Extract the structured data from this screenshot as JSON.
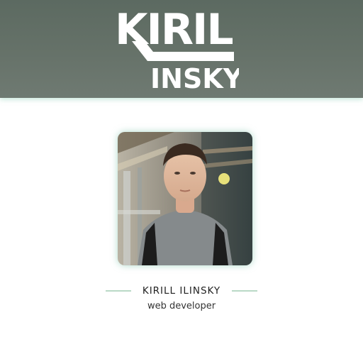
{
  "header": {
    "logo": {
      "line1": "KIRIL",
      "line2": "INSKY"
    }
  },
  "profile": {
    "photo_alt": "portrait photo",
    "name": "KIRILL ILINSKY",
    "role": "web developer"
  },
  "colors": {
    "header_bg": "#5f6c63",
    "accent_rule": "#b9d9c6",
    "photo_glow": "#6ebea0"
  }
}
